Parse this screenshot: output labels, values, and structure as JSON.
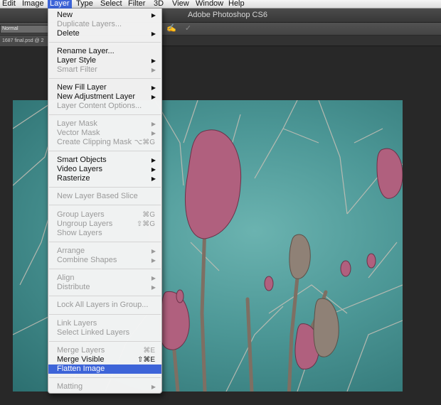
{
  "menubar": {
    "items": [
      "Edit",
      "Image",
      "Layer",
      "Type",
      "Select",
      "Filter",
      "3D",
      "View",
      "Window",
      "Help"
    ],
    "active": "Layer"
  },
  "app": {
    "title": "Adobe Photoshop CS6"
  },
  "options": {
    "blend_mode": "Normal",
    "icons": [
      "pressure-opacity-icon",
      "pressure-size-icon"
    ]
  },
  "document": {
    "tab_label": "1687 final.psd @ 2"
  },
  "layer_menu": {
    "items": [
      {
        "label": "New",
        "submenu": true,
        "disabled": false
      },
      {
        "label": "Duplicate Layers...",
        "disabled": true
      },
      {
        "label": "Delete",
        "submenu": true,
        "disabled": false
      },
      {
        "label": "Rename Layer...",
        "disabled": false
      },
      {
        "label": "Layer Style",
        "submenu": true,
        "disabled": false
      },
      {
        "label": "Smart Filter",
        "submenu": true,
        "disabled": true
      },
      {
        "label": "New Fill Layer",
        "submenu": true,
        "disabled": false
      },
      {
        "label": "New Adjustment Layer",
        "submenu": true,
        "disabled": false
      },
      {
        "label": "Layer Content Options...",
        "disabled": true
      },
      {
        "label": "Layer Mask",
        "submenu": true,
        "disabled": true
      },
      {
        "label": "Vector Mask",
        "submenu": true,
        "disabled": true
      },
      {
        "label": "Create Clipping Mask",
        "shortcut": "⌥⌘G",
        "disabled": true
      },
      {
        "label": "Smart Objects",
        "submenu": true,
        "disabled": false
      },
      {
        "label": "Video Layers",
        "submenu": true,
        "disabled": false
      },
      {
        "label": "Rasterize",
        "submenu": true,
        "disabled": false
      },
      {
        "label": "New Layer Based Slice",
        "disabled": true
      },
      {
        "label": "Group Layers",
        "shortcut": "⌘G",
        "disabled": true
      },
      {
        "label": "Ungroup Layers",
        "shortcut": "⇧⌘G",
        "disabled": true
      },
      {
        "label": "Show Layers",
        "disabled": true
      },
      {
        "label": "Arrange",
        "submenu": true,
        "disabled": true
      },
      {
        "label": "Combine Shapes",
        "submenu": true,
        "disabled": true
      },
      {
        "label": "Align",
        "submenu": true,
        "disabled": true
      },
      {
        "label": "Distribute",
        "submenu": true,
        "disabled": true
      },
      {
        "label": "Lock All Layers in Group...",
        "disabled": true
      },
      {
        "label": "Link Layers",
        "disabled": true
      },
      {
        "label": "Select Linked Layers",
        "disabled": true
      },
      {
        "label": "Merge Layers",
        "shortcut": "⌘E",
        "disabled": true
      },
      {
        "label": "Merge Visible",
        "shortcut": "⇧⌘E",
        "disabled": false
      },
      {
        "label": "Flatten Image",
        "disabled": false,
        "highlighted": true
      },
      {
        "label": "Matting",
        "submenu": true,
        "disabled": true
      }
    ]
  },
  "colors": {
    "highlight": "#3d64d8",
    "sky": "#4c9796",
    "blossom": "#b0607e"
  }
}
